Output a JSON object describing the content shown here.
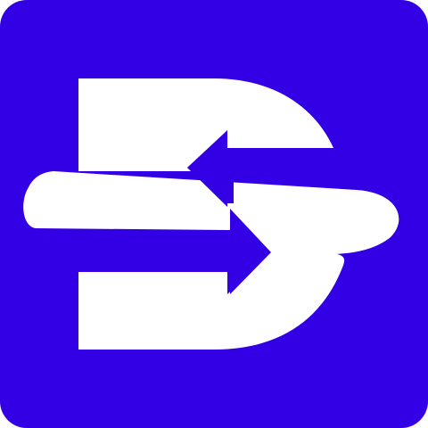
{
  "icon": {
    "name": "swap-arrows-logo",
    "background_color": "#3300e6",
    "foreground_color": "#ffffff"
  }
}
